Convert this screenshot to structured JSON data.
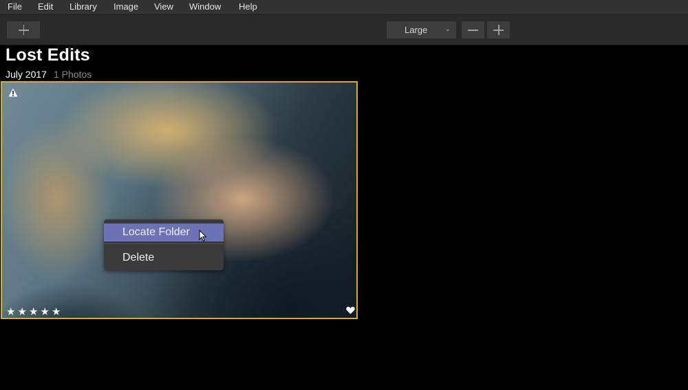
{
  "menubar": {
    "items": [
      "File",
      "Edit",
      "Library",
      "Image",
      "View",
      "Window",
      "Help"
    ]
  },
  "toolbar": {
    "add_icon": "plus-icon",
    "size_select_value": "Large",
    "zoom_out_icon": "minus-icon",
    "zoom_in_icon": "plus-icon"
  },
  "album": {
    "title": "Lost Edits",
    "date": "July 2017",
    "count": "1 Photos"
  },
  "photo": {
    "rating": 5,
    "rating_max": 5,
    "favorite": true,
    "warning": true,
    "selection_color": "#e0a43a"
  },
  "context_menu": {
    "items": [
      "Locate Folder",
      "Delete"
    ],
    "highlight_color": "#6b72b5"
  }
}
